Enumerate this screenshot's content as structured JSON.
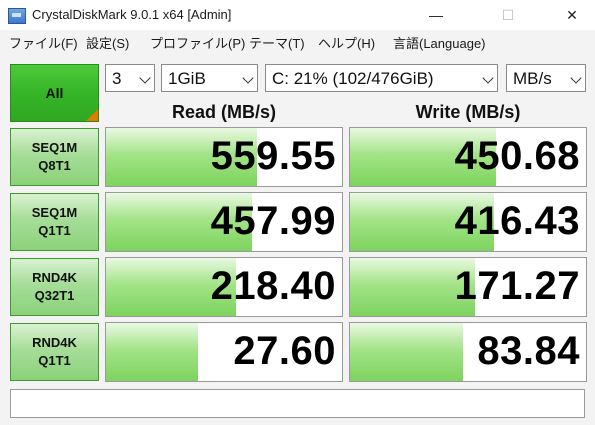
{
  "window": {
    "title": "CrystalDiskMark 9.0.1 x64 [Admin]",
    "minimize": "—",
    "maximize": "☐",
    "close": "✕"
  },
  "menu": [
    "ファイル(F)",
    "設定(S)",
    "プロファイル(P)",
    "テーマ(T)",
    "ヘルプ(H)",
    "言語(Language)"
  ],
  "controls": {
    "all_label": "All",
    "count": "3",
    "size": "1GiB",
    "drive": "C: 21% (102/476GiB)",
    "unit": "MB/s"
  },
  "headers": {
    "read": "Read (MB/s)",
    "write": "Write (MB/s)"
  },
  "tests": [
    {
      "line1": "SEQ1M",
      "line2": "Q8T1",
      "read": "559.55",
      "write": "450.68",
      "read_fill": 0.64,
      "write_fill": 0.62
    },
    {
      "line1": "SEQ1M",
      "line2": "Q1T1",
      "read": "457.99",
      "write": "416.43",
      "read_fill": 0.62,
      "write_fill": 0.61
    },
    {
      "line1": "RND4K",
      "line2": "Q32T1",
      "read": "218.40",
      "write": "171.27",
      "read_fill": 0.55,
      "write_fill": 0.53
    },
    {
      "line1": "RND4K",
      "line2": "Q1T1",
      "read": "27.60",
      "write": "83.84",
      "read_fill": 0.39,
      "write_fill": 0.48
    }
  ],
  "comment": ""
}
